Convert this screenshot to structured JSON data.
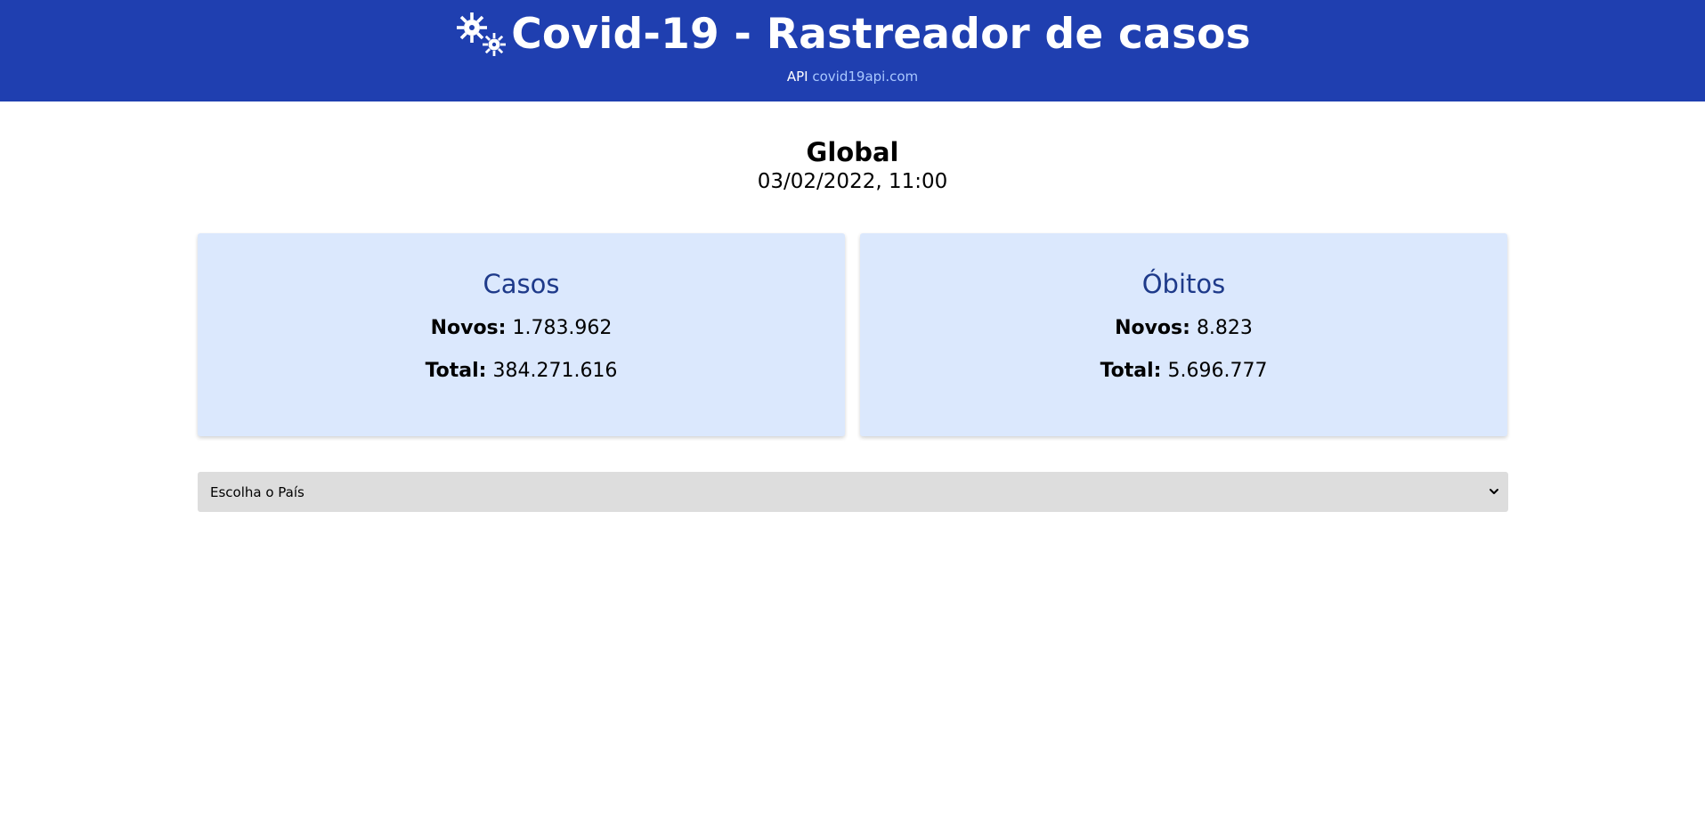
{
  "header": {
    "title": "Covid-19 - Rastreador de casos",
    "logo_icon": "virus-icon",
    "api_prefix": "API",
    "api_link": "covid19api.com",
    "background_color": "#1f3fb0",
    "link_color": "#a9c8ff"
  },
  "summary": {
    "region": "Global",
    "date": "03/02/2022, 11:00"
  },
  "cards": {
    "cases": {
      "title": "Casos",
      "new_label": "Novos:",
      "new_value": "1.783.962",
      "total_label": "Total:",
      "total_value": "384.271.616"
    },
    "deaths": {
      "title": "Óbitos",
      "new_label": "Novos:",
      "new_value": "8.823",
      "total_label": "Total:",
      "total_value": "5.696.777"
    },
    "card_background": "#dbe8fd",
    "title_color": "#1e3a8a"
  },
  "country_select": {
    "selected": "Escolha o País",
    "chevron_icon": "chevron-down-icon"
  }
}
